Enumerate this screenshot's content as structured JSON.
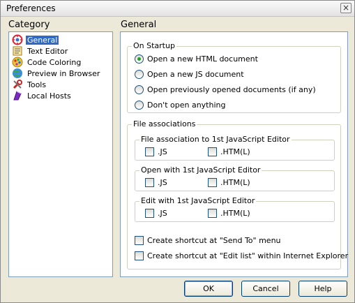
{
  "window": {
    "title": "Preferences",
    "close_glyph": "×"
  },
  "category": {
    "heading": "Category",
    "items": [
      {
        "label": "General",
        "icon": "general-icon",
        "selected": true
      },
      {
        "label": "Text Editor",
        "icon": "text-editor-icon",
        "selected": false
      },
      {
        "label": "Code Coloring",
        "icon": "code-coloring-icon",
        "selected": false
      },
      {
        "label": "Preview in Browser",
        "icon": "preview-browser-icon",
        "selected": false
      },
      {
        "label": "Tools",
        "icon": "tools-icon",
        "selected": false
      },
      {
        "label": "Local Hosts",
        "icon": "local-hosts-icon",
        "selected": false
      }
    ]
  },
  "general": {
    "heading": "General",
    "startup": {
      "label": "On Startup",
      "options": [
        {
          "label": "Open a new HTML document",
          "checked": true
        },
        {
          "label": "Open a new JS document",
          "checked": false
        },
        {
          "label": "Open previously opened documents (if any)",
          "checked": false
        },
        {
          "label": "Don't open anything",
          "checked": false
        }
      ]
    },
    "associations": {
      "label": "File associations",
      "groups": [
        {
          "label": "File association to 1st JavaScript Editor",
          "js": ".JS",
          "htm": ".HTM(L)"
        },
        {
          "label": "Open with 1st JavaScript Editor",
          "js": ".JS",
          "htm": ".HTM(L)"
        },
        {
          "label": "Edit with 1st JavaScript Editor",
          "js": ".JS",
          "htm": ".HTM(L)"
        }
      ],
      "shortcut_send_to": "Create shortcut at \"Send To\" menu",
      "shortcut_edit_list": "Create shortcut at \"Edit list\" within Internet Explorer"
    }
  },
  "buttons": {
    "ok": "OK",
    "cancel": "Cancel",
    "help": "Help"
  }
}
